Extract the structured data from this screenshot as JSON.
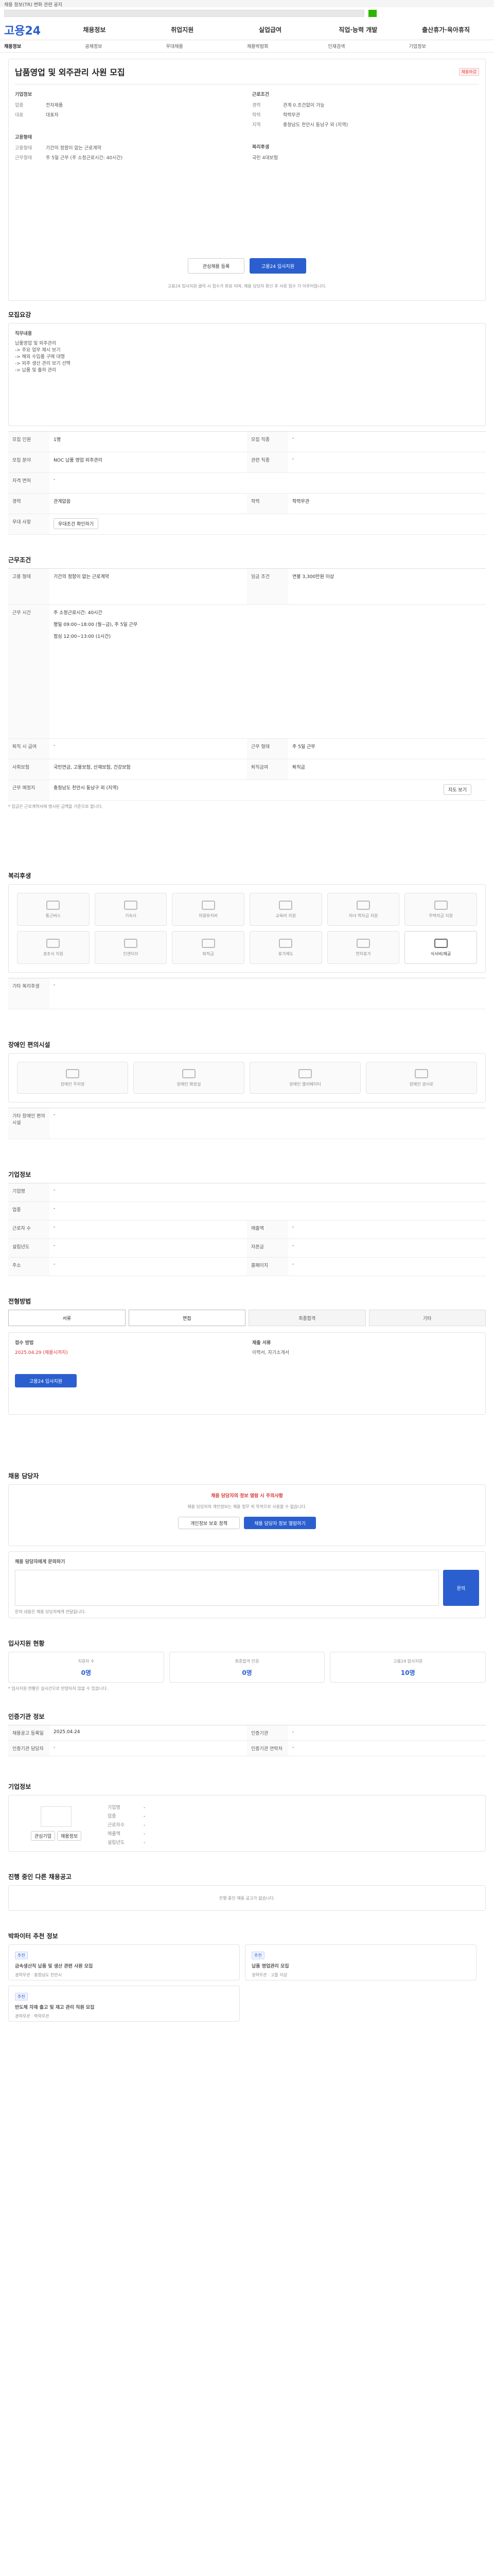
{
  "top": {
    "notice": "채용 정보(TR) 변화 관련 공지"
  },
  "gnb": {
    "logo": "고용24",
    "menus": [
      "채용정보",
      "취업지원",
      "실업급여",
      "직업·능력 개발",
      "출산휴가·육아휴직"
    ]
  },
  "subnav": [
    "채용정보",
    "공채정보",
    "우대채용",
    "채용박람회",
    "인재검색",
    "기업정보"
  ],
  "job": {
    "title": "납품영업 및 외주관리 사원 모집",
    "badge": "채용마감",
    "company_label": "기업정보",
    "fields": [
      [
        "업종",
        "전자제품"
      ],
      [
        "대표",
        "대표자"
      ],
      [
        "근로조건",
        ""
      ],
      [
        "경력",
        "관계 0.조건없이 가능"
      ],
      [
        "학력",
        "학력무관"
      ],
      [
        "지역",
        "충청남도 천안시 동남구 외 (지역)"
      ],
      [
        "고용형태",
        ""
      ],
      [
        "고용형태",
        "기간의 정함이 없는 근로계약"
      ],
      [
        "근무형태",
        "주 5일 근무 (주 소정근로시간: 40시간)"
      ],
      [
        "복리후생",
        ""
      ],
      [
        "",
        "국민 4대보험"
      ]
    ],
    "scrap": "관심채용 등록",
    "apply": "고용24 입사지원",
    "notice": "고용24 입사지원 클릭 시 접수가 완료 되며, 채용 담당자 회신 후 서류 접수 가 이루어집니다."
  },
  "recruit": {
    "title": "모집요강",
    "duty_label": "직무내용",
    "duty": [
      "납품영업 및 외주관리",
      "-> 주요 업무 제시 보기",
      "-> 해외 수입품 구매 대행",
      "-> 외주 생산 관리 보기 선택",
      "-> 납품 및 출하 관리"
    ],
    "rows": [
      [
        "모집 인원",
        "1명",
        "모집 직종",
        "-"
      ],
      [
        "모집 분야",
        "NOC 납품 영업 외주관리",
        "관련 직종",
        "-"
      ],
      [
        "자격 면허",
        "-",
        "",
        ""
      ],
      [
        "경력",
        "관계없음",
        "학력",
        "학력무관"
      ],
      [
        "우대 사항",
        "-",
        "",
        ""
      ]
    ],
    "prefer_btn": "우대조건 확인하기"
  },
  "cond": {
    "title": "근무조건",
    "rows": [
      [
        "고용 형태",
        "기간의 정함이 없는 근로계약",
        "임금 조건",
        "연봉 3,300만원 이상"
      ],
      [
        "근무 시간",
        "주 소정근로시간: 40시간",
        "",
        ""
      ],
      [
        "근무 시간 상세",
        "평일 09:00~18:00 (월~금), 주 5일 근무",
        "",
        ""
      ],
      [
        "휴게시간",
        "점심 12:00~13:00 (1시간)",
        "",
        ""
      ],
      [
        "퇴직 시 급여",
        "-",
        "근무 형태",
        "주 5일 근무"
      ],
      [
        "사회보험",
        "국민연금, 고용보험, 산재보험, 건강보험",
        "퇴직금여",
        "퇴직금"
      ],
      [
        "근무 예정지",
        "충청남도 천안시 동남구 외 (지역)",
        "",
        ""
      ]
    ],
    "note": "* 임금은 근로계약서에 명시된 금액을 기준으로 합니다.",
    "map_btn": "지도 보기"
  },
  "welfare": {
    "title": "복리후생",
    "items": [
      "통근버스",
      "기숙사",
      "차량유지비",
      "교육비 지원",
      "자녀 학자금 지원",
      "주택자금 지원",
      "경조사 지원",
      "인센티브",
      "퇴직금",
      "휴가제도",
      "연차휴가",
      "식사비/제공"
    ],
    "etc_label": "기타 복리후생",
    "etc": "-"
  },
  "facility": {
    "title": "장애인 편의시설",
    "items": [
      "장애인 주차장",
      "장애인 화장실",
      "장애인 엘리베이터",
      "장애인 경사로"
    ],
    "etc_label": "기타 장애인 편의시설",
    "etc": "-"
  },
  "company": {
    "title": "기업정보",
    "rows": [
      [
        "기업명",
        "-",
        "",
        ""
      ],
      [
        "업종",
        "-",
        "",
        ""
      ],
      [
        "근로자 수",
        "-",
        "매출액",
        "-"
      ],
      [
        "설립년도",
        "-",
        "자본금",
        "-"
      ],
      [
        "주소",
        "-",
        "홈페이지",
        "-"
      ]
    ]
  },
  "process": {
    "title": "전형방법",
    "steps": [
      "서류",
      "면접",
      "최종합격",
      "기타"
    ],
    "method": [
      "접수 방법",
      "고용24 입사지원",
      "접수 마감일",
      "2025.04.29 (채용시까지)"
    ],
    "docs": [
      "제출 서류",
      "이력서, 자기소개서"
    ],
    "apply_btn": "고용24 입사지원"
  },
  "contact": {
    "title": "채용 담당자",
    "warn": "채용 담당자의 정보 열람 시 주의사항",
    "desc": "채용 담당자의 개인정보는 채용 업무 외 목적으로 사용할 수 없습니다.",
    "btn1": "개인정보 보호 정책",
    "btn2": "채용 담당자 정보 열람하기"
  },
  "qa": {
    "title": "채용 담당자에게 문의하기",
    "btn": "문의",
    "note": "문의 내용은 채용 담당자에게 전달됩니다."
  },
  "stat": {
    "title": "입사지원 현황",
    "cards": [
      [
        "지원자 수",
        "0명"
      ],
      [
        "최종합격 인원",
        "0명"
      ],
      [
        "고용24 입사지원",
        "10명"
      ]
    ],
    "note": "* 입사지원 현황은 실시간으로 반영되지 않을 수 있습니다."
  },
  "info": {
    "title": "인증기관 정보",
    "rows": [
      [
        "채용공고 등록일",
        "2025.04.24",
        "인증기관",
        "-"
      ],
      [
        "인증기관 담당자",
        "-",
        "인증기관 연락처",
        "-"
      ]
    ]
  },
  "corp": {
    "title": "기업정보",
    "btn1": "관심기업",
    "btn2": "채용정보",
    "cols": [
      [
        "기업명",
        "-"
      ],
      [
        "업종",
        "-"
      ],
      [
        "근로자수",
        "-"
      ],
      [
        "매출액",
        "-"
      ],
      [
        "설립년도",
        "-"
      ]
    ]
  },
  "other": {
    "title": "진행 중인 다른 채용공고",
    "empty": "진행 중인 채용 공고가 없습니다."
  },
  "rec": {
    "title": "박파이터 추천 정보",
    "cards": [
      {
        "tag": "추천",
        "title": "금속생산직 납품 및 생산 관련 사원 모집",
        "sub": "경력무관 · 충청남도 천안시"
      },
      {
        "tag": "추천",
        "title": "납품 영업관리 모집",
        "sub": "경력무관 · 고졸 이상"
      },
      {
        "tag": "추천",
        "title": "반도체 자재 출고 및 재고 관리 직원 모집",
        "sub": "경력무관 · 학력무관"
      }
    ]
  }
}
